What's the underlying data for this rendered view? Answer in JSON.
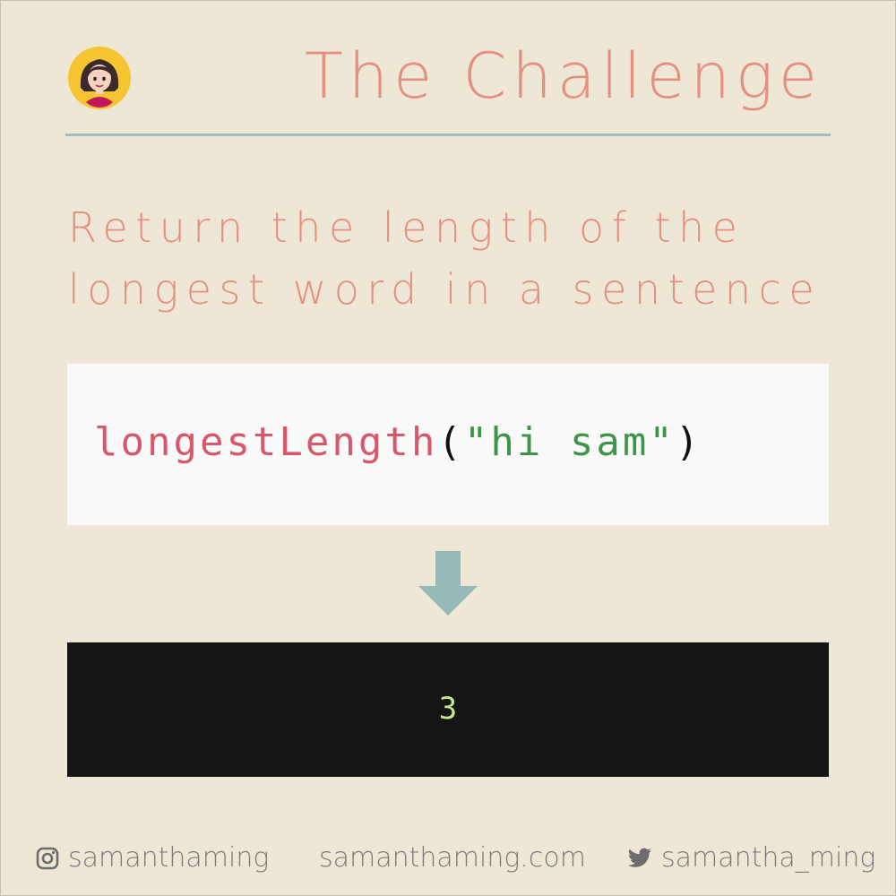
{
  "header": {
    "title": "The Challenge"
  },
  "prompt": {
    "line1": "Return the length of the",
    "line2": "longest word in a sentence"
  },
  "code": {
    "function_name": "longestLength",
    "open_paren": "(",
    "argument": "\"hi sam\"",
    "close_paren": ")"
  },
  "output": {
    "value": "3"
  },
  "footer": {
    "instagram": "samanthaming",
    "website": "samanthaming.com",
    "twitter": "samantha_ming"
  },
  "colors": {
    "background": "#efe7d6",
    "accent": "#e58f80",
    "rule": "#9dbfbd",
    "function": "#d9576b",
    "string": "#3e9447",
    "output_text": "#c3e88d",
    "output_bg": "#151515"
  },
  "icons": [
    "avatar-icon",
    "arrow-down-icon",
    "instagram-icon",
    "twitter-icon"
  ]
}
